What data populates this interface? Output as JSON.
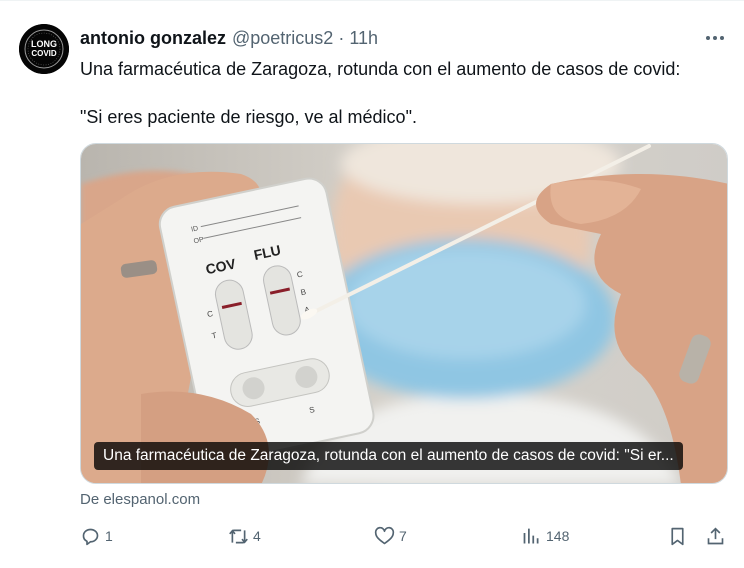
{
  "author": {
    "name": "antonio gonzalez",
    "handle": "@poetricus2",
    "separator": "·",
    "time": "11h",
    "avatar_text": [
      "LONG",
      "COVID"
    ]
  },
  "tweet": {
    "text_line1": "Una farmacéutica de Zaragoza, rotunda con el aumento de casos de covid:",
    "text_line2": "\"Si eres paciente de riesgo, ve al médico\"."
  },
  "card": {
    "caption": "Una farmacéutica de Zaragoza, rotunda con el aumento de casos de covid: \"Si er...",
    "source": "De elespanol.com",
    "image_text": {
      "id": "ID",
      "op": "OP",
      "cov": "COV",
      "flu": "FLU",
      "c": "C",
      "t": "T",
      "b": "B",
      "a": "A",
      "s": "S"
    }
  },
  "actions": {
    "replies": "1",
    "retweets": "4",
    "likes": "7",
    "views": "148"
  },
  "icons": [
    "more-icon",
    "reply-icon",
    "retweet-icon",
    "like-icon",
    "views-icon",
    "bookmark-icon",
    "share-icon"
  ],
  "colors": {
    "text": "#0f1419",
    "secondary": "#536471",
    "border": "#cfd9de",
    "mask": "#8fc6e3"
  }
}
